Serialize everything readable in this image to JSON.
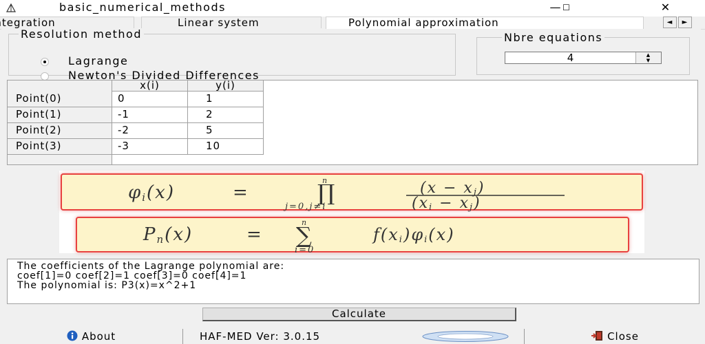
{
  "window": {
    "title": "basic_numerical_methods",
    "minimize": "—",
    "maximize": "☐",
    "close": "✕"
  },
  "tabs": [
    {
      "label": "Integration"
    },
    {
      "label": "Linear system"
    },
    {
      "label": "Polynomial approximation"
    }
  ],
  "tab_scroll": {
    "left": "◄",
    "right": "►"
  },
  "resolution": {
    "legend": "Resolution method",
    "options": [
      {
        "label": "Lagrange",
        "selected": true
      },
      {
        "label": "Newton's Divided Differences",
        "selected": false
      }
    ]
  },
  "equations": {
    "legend": "Nbre equations",
    "value": "4"
  },
  "table": {
    "columns": [
      "x(i)",
      "y(i)"
    ],
    "rows": [
      {
        "label": "Point(0)",
        "x": "0",
        "y": "1"
      },
      {
        "label": "Point(1)",
        "x": "-1",
        "y": "2"
      },
      {
        "label": "Point(2)",
        "x": "-2",
        "y": "5"
      },
      {
        "label": "Point(3)",
        "x": "-3",
        "y": "10"
      }
    ]
  },
  "output": {
    "lines": [
      "The coefficients of the Lagrange polynomial are:",
      "coef[1]=0  coef[2]=1  coef[3]=0  coef[4]=1",
      "The polynomial is: P3(x)=x^2+1"
    ]
  },
  "calculate_label": "Calculate",
  "status": {
    "about_label": "About",
    "version": "HAF-MED Ver: 3.0.15",
    "close_label": "Close"
  },
  "colors": {
    "formula_bg": "#fdf4ca",
    "formula_border": "#e8413f",
    "about_icon": "#1f5fbf",
    "close_icon": "#c0392b"
  }
}
